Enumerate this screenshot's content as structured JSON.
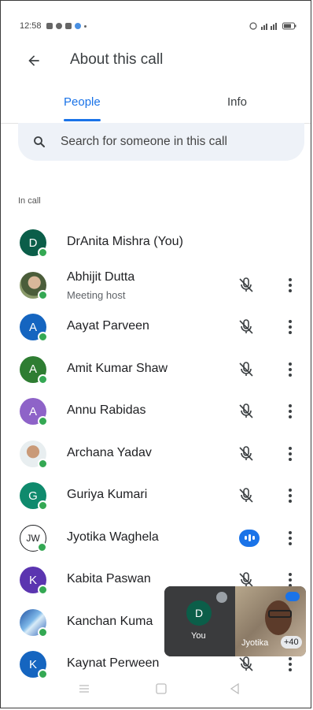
{
  "status_bar": {
    "time": "12:58",
    "right_text": "ᵛᵒˡᵗᵉ"
  },
  "header": {
    "title": "About this call"
  },
  "tabs": [
    {
      "label": "People",
      "active": true
    },
    {
      "label": "Info",
      "active": false
    }
  ],
  "search": {
    "placeholder": "Search for someone in this call"
  },
  "section_label": "In call",
  "participants": [
    {
      "name": "DrAnita Mishra (You)",
      "initial": "D",
      "color": "#0b5e49",
      "mic": "none"
    },
    {
      "name": "Abhijit Dutta",
      "sub": "Meeting host",
      "photo": true,
      "mic": "muted"
    },
    {
      "name": "Aayat Parveen",
      "initial": "A",
      "color": "#1565c0",
      "mic": "muted"
    },
    {
      "name": "Amit Kumar Shaw",
      "initial": "A",
      "color": "#2e7d32",
      "mic": "muted"
    },
    {
      "name": "Annu Rabidas",
      "initial": "A",
      "color": "#8e63c8",
      "mic": "muted"
    },
    {
      "name": "Archana Yadav",
      "photo": true,
      "mic": "muted"
    },
    {
      "name": "Guriya Kumari",
      "initial": "G",
      "color": "#0f8a6d",
      "mic": "muted"
    },
    {
      "name": "Jyotika Waghela",
      "initial": "JW",
      "outline": true,
      "mic": "speaking"
    },
    {
      "name": "Kabita Paswan",
      "initial": "K",
      "color": "#5b35b0",
      "mic": "muted"
    },
    {
      "name": "Kanchan Kuma",
      "photo": true,
      "mic": "muted"
    },
    {
      "name": "Kaynat Perween",
      "initial": "K",
      "color": "#1565c0",
      "mic": "muted"
    }
  ],
  "pip": {
    "self_initial": "D",
    "self_label": "You",
    "other_label": "Jyotika",
    "other_count": "+40"
  },
  "colors": {
    "accent": "#1a73e8",
    "presence": "#34a853"
  }
}
